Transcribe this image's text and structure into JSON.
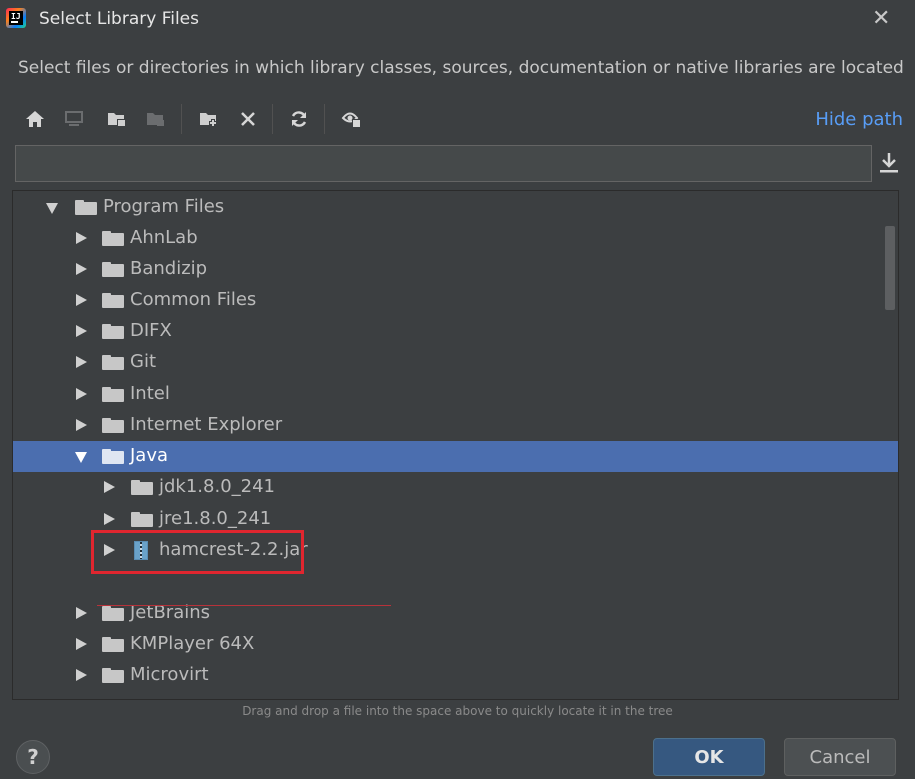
{
  "window": {
    "title": "Select Library Files",
    "description": "Select files or directories in which library classes, sources, documentation or native libraries are located"
  },
  "toolbar": {
    "icons": [
      "home-icon",
      "desktop-icon",
      "project-folder-icon",
      "module-folder-icon",
      "new-folder-icon",
      "delete-icon",
      "refresh-icon",
      "show-hidden-icon"
    ],
    "hide_path_label": "Hide path"
  },
  "path_field": {
    "value": "",
    "placeholder": ""
  },
  "tree": {
    "items": [
      {
        "label": "Program Files",
        "expanded": true,
        "type": "folder"
      },
      {
        "label": "AhnLab",
        "expanded": false,
        "type": "folder"
      },
      {
        "label": "Bandizip",
        "expanded": false,
        "type": "folder"
      },
      {
        "label": "Common Files",
        "expanded": false,
        "type": "folder"
      },
      {
        "label": "DIFX",
        "expanded": false,
        "type": "folder"
      },
      {
        "label": "Git",
        "expanded": false,
        "type": "folder"
      },
      {
        "label": "Intel",
        "expanded": false,
        "type": "folder"
      },
      {
        "label": "Internet Explorer",
        "expanded": false,
        "type": "folder"
      },
      {
        "label": "Java",
        "expanded": true,
        "type": "folder",
        "selected": true
      },
      {
        "label": "jdk1.8.0_241",
        "expanded": false,
        "type": "folder"
      },
      {
        "label": "jre1.8.0_241",
        "expanded": false,
        "type": "folder"
      },
      {
        "label": "hamcrest-2.2.jar",
        "expanded": false,
        "type": "jar"
      },
      {
        "label": "JetBrains",
        "expanded": false,
        "type": "folder"
      },
      {
        "label": "KMPlayer 64X",
        "expanded": false,
        "type": "folder"
      },
      {
        "label": "Microvirt",
        "expanded": false,
        "type": "folder"
      }
    ]
  },
  "hint": "Drag and drop a file into the space above to quickly locate it in the tree",
  "buttons": {
    "help": "?",
    "ok": "OK",
    "cancel": "Cancel"
  },
  "colors": {
    "selection": "#4b6eaf",
    "link": "#589df6",
    "highlight": "#e0262f",
    "background": "#3c3f41"
  }
}
